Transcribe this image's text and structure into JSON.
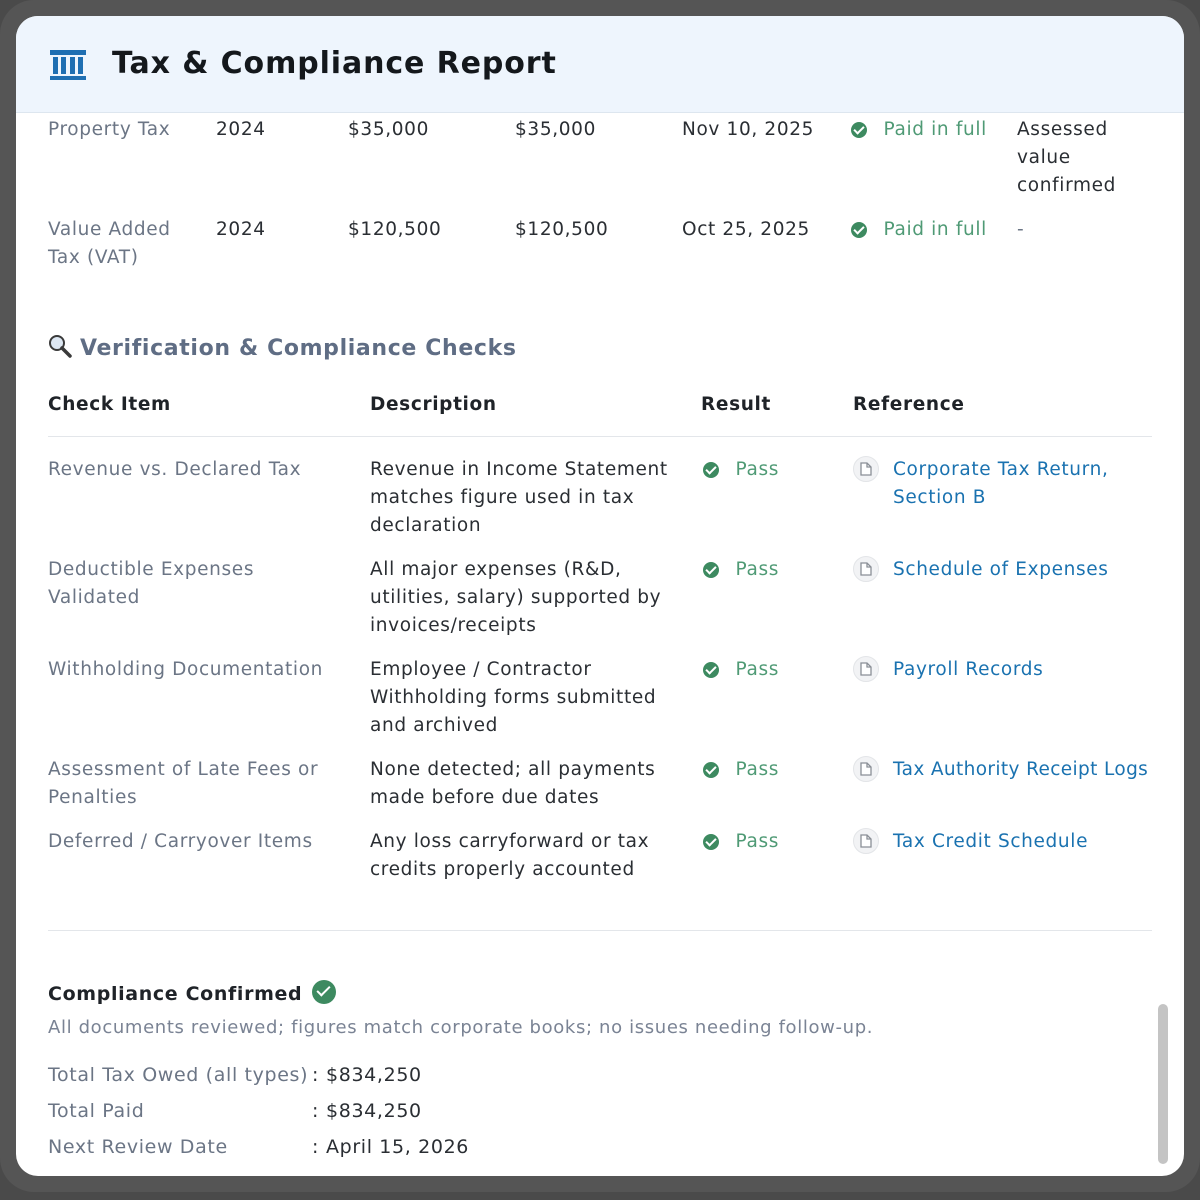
{
  "header": {
    "title": "Tax & Compliance Report",
    "icon": "bank-icon"
  },
  "tax_rows": [
    {
      "type": "Property Tax",
      "year": "2024",
      "owed": "$35,000",
      "paid": "$35,000",
      "date": "Nov 10, 2025",
      "status": "Paid in full",
      "note": "Assessed value confirmed"
    },
    {
      "type": "Value Added Tax (VAT)",
      "year": "2024",
      "owed": "$120,500",
      "paid": "$120,500",
      "date": "Oct 25, 2025",
      "status": "Paid in full",
      "note": "-"
    }
  ],
  "checks_section": {
    "title": "Verification & Compliance Checks",
    "columns": [
      "Check Item",
      "Description",
      "Result",
      "Reference"
    ],
    "rows": [
      {
        "item": "Revenue vs. Declared Tax",
        "description": "Revenue in Income Statement matches figure used in tax declaration",
        "result": "Pass",
        "reference": "Corporate Tax Return, Section B"
      },
      {
        "item": "Deductible Expenses Validated",
        "description": "All major expenses (R&D, utilities, salary) supported by invoices/receipts",
        "result": "Pass",
        "reference": "Schedule of Expenses"
      },
      {
        "item": "Withholding Documentation",
        "description": "Employee / Contractor Withholding forms submitted and archived",
        "result": "Pass",
        "reference": "Payroll Records"
      },
      {
        "item": "Assessment of Late Fees or Penalties",
        "description": "None detected; all payments made before due dates",
        "result": "Pass",
        "reference": "Tax Authority Receipt Logs"
      },
      {
        "item": "Deferred / Carryover Items",
        "description": "Any loss carryforward or tax credits properly accounted",
        "result": "Pass",
        "reference": "Tax Credit Schedule"
      }
    ]
  },
  "summary": {
    "title": "Compliance Confirmed",
    "note": "All documents reviewed; figures match corporate books; no issues needing follow-up.",
    "items": [
      {
        "label": "Total Tax Owed (all types)",
        "separator": ":",
        "value": "$834,250"
      },
      {
        "label": "Total Paid",
        "separator": ":",
        "value": "$834,250"
      },
      {
        "label": "Next Review Date",
        "separator": ":",
        "value": "April 15, 2026"
      }
    ]
  },
  "colors": {
    "pass_green": "#3d8a60",
    "link_blue": "#1a72b0",
    "header_bg": "#eef5fd"
  }
}
